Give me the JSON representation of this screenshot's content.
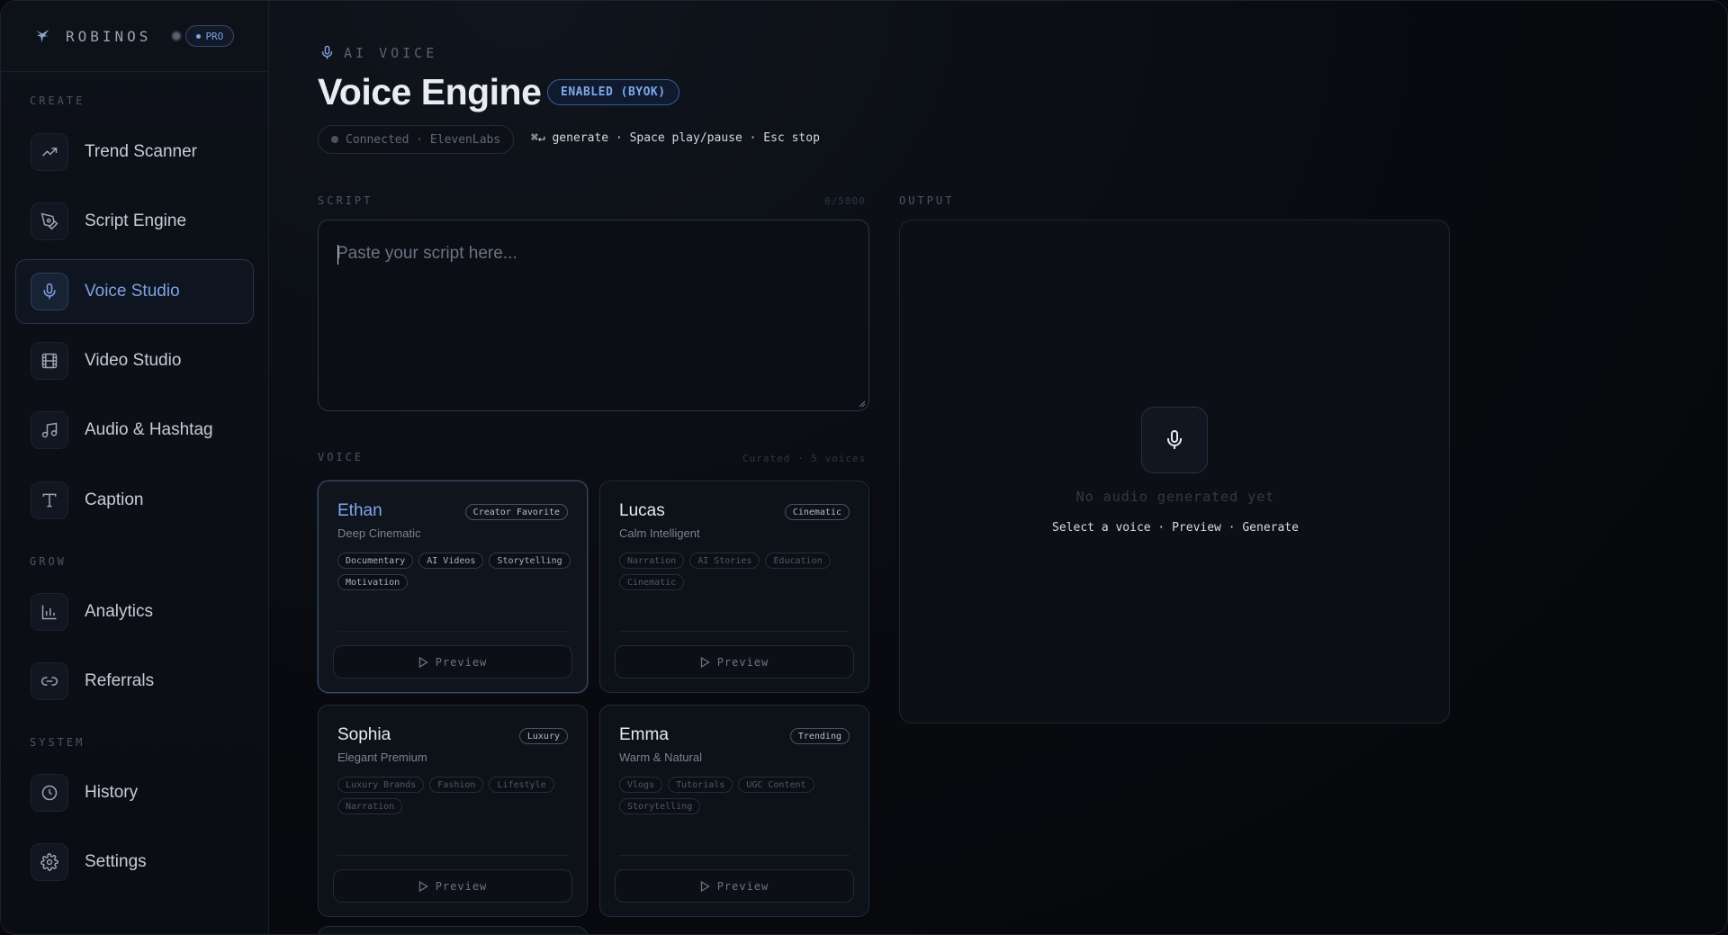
{
  "brand": {
    "name": "ROBINOS",
    "plan": "PRO"
  },
  "sidebar": {
    "sections": [
      {
        "label": "CREATE"
      },
      {
        "label": "GROW"
      },
      {
        "label": "SYSTEM"
      }
    ],
    "items": [
      {
        "label": "Trend Scanner",
        "icon": "trend-icon"
      },
      {
        "label": "Script Engine",
        "icon": "pen-icon"
      },
      {
        "label": "Voice Studio",
        "icon": "mic-icon",
        "active": true
      },
      {
        "label": "Video Studio",
        "icon": "film-icon"
      },
      {
        "label": "Audio & Hashtag",
        "icon": "music-icon"
      },
      {
        "label": "Caption",
        "icon": "text-icon"
      },
      {
        "label": "Analytics",
        "icon": "bar-chart-icon"
      },
      {
        "label": "Referrals",
        "icon": "link-icon"
      },
      {
        "label": "History",
        "icon": "clock-icon"
      },
      {
        "label": "Settings",
        "icon": "gear-icon"
      }
    ]
  },
  "header": {
    "eyebrow": "AI VOICE",
    "title": "Voice Engine",
    "badge": "ENABLED (BYOK)",
    "status": "Connected · ElevenLabs",
    "shortcuts": "⌘↵ generate · Space play/pause · Esc stop"
  },
  "script": {
    "label": "SCRIPT",
    "counter": "0/5000",
    "placeholder": "Paste your script here..."
  },
  "voice": {
    "label": "VOICE",
    "meta": "Curated · 5 voices",
    "preview_label": "Preview",
    "cards": [
      {
        "name": "Ethan",
        "subtitle": "Deep Cinematic",
        "tag": "Creator Favorite",
        "chips": [
          "Documentary",
          "AI Videos",
          "Storytelling",
          "Motivation"
        ],
        "selected": true
      },
      {
        "name": "Lucas",
        "subtitle": "Calm Intelligent",
        "tag": "Cinematic",
        "chips": [
          "Narration",
          "AI Stories",
          "Education",
          "Cinematic"
        ]
      },
      {
        "name": "Sophia",
        "subtitle": "Elegant Premium",
        "tag": "Luxury",
        "chips": [
          "Luxury Brands",
          "Fashion",
          "Lifestyle",
          "Narration"
        ]
      },
      {
        "name": "Emma",
        "subtitle": "Warm & Natural",
        "tag": "Trending",
        "chips": [
          "Vlogs",
          "Tutorials",
          "UGC Content",
          "Storytelling"
        ]
      }
    ]
  },
  "output": {
    "label": "OUTPUT",
    "empty": "No audio generated yet",
    "hint": "Select a voice · Preview · Generate"
  },
  "colors": {
    "accent": "#7fa8ec",
    "background": "#06080c"
  }
}
